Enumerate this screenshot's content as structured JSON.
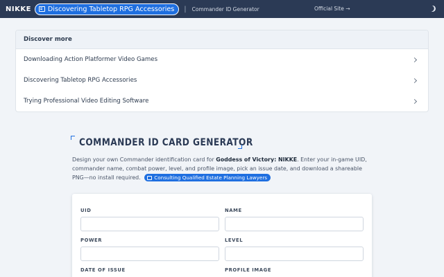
{
  "topbar": {
    "brand": "NIKKE",
    "pill_icon": "book-icon",
    "pill_label": "Discovering Tabletop RPG Accessories",
    "separator": "|",
    "breadcrumb": "Commander ID Generator",
    "official_site": "Official Site →",
    "theme_icon": "moon-icon"
  },
  "discover": {
    "heading": "Discover more",
    "items": [
      {
        "label": "Downloading Action Platformer Video Games"
      },
      {
        "label": "Discovering Tabletop RPG Accessories"
      },
      {
        "label": "Trying Professional Video Editing Software"
      }
    ]
  },
  "hero": {
    "title": "COMMANDER ID CARD GENERATOR",
    "desc_before": "Design your own Commander identification card for ",
    "desc_game": "Goddess of Victory: NIKKE",
    "desc_after": ". Enter your in-game UID, commander name, combat power, level, and profile image, pick an issue date, and download a shareable PNG—no install required.",
    "badge_label": "Consulting Qualified Estate Planning Lawyers"
  },
  "form": {
    "uid_label": "UID",
    "name_label": "NAME",
    "power_label": "POWER",
    "level_label": "LEVEL",
    "date_label": "DATE OF ISSUE",
    "image_label": "PROFILE IMAGE"
  },
  "colors": {
    "topbar": "#2b3a55",
    "accent": "#1f6fe0",
    "background": "#f1f4f8"
  }
}
